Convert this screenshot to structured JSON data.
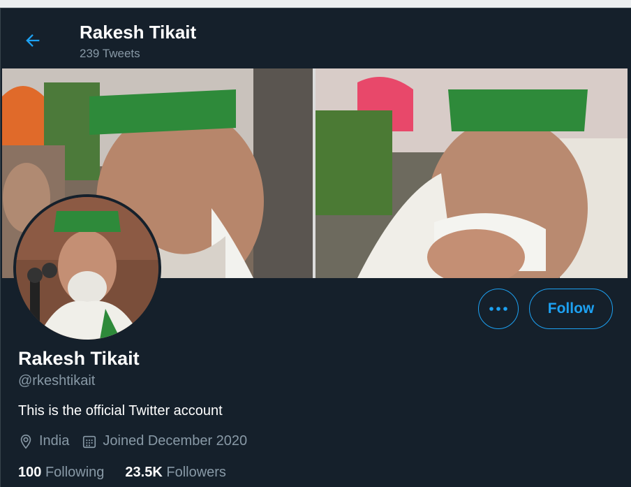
{
  "header": {
    "title": "Rakesh Tikait",
    "tweet_count": "239 Tweets"
  },
  "profile": {
    "name": "Rakesh Tikait",
    "handle": "@rkeshtikait",
    "bio": "This is the official Twitter account",
    "location": "India",
    "joined": "Joined December 2020"
  },
  "actions": {
    "more_icon": "more-dots-icon",
    "follow_label": "Follow"
  },
  "stats": {
    "following_count": "100",
    "following_label": "Following",
    "followers_count": "23.5K",
    "followers_label": "Followers"
  },
  "colors": {
    "background": "#15202b",
    "accent": "#1da1f2",
    "secondary_text": "#8899a6"
  }
}
